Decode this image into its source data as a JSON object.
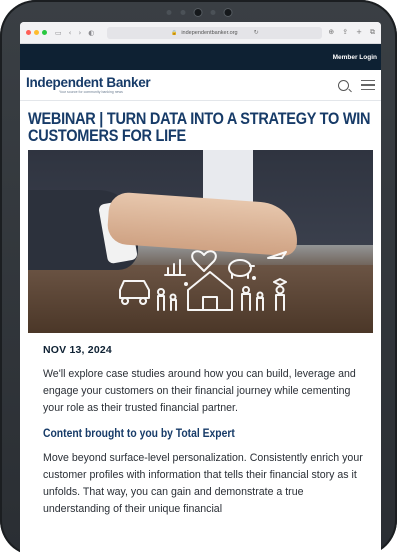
{
  "browser": {
    "url": "independentbanker.org"
  },
  "site": {
    "member_login": "Member Login",
    "logo_text": "Independent Banker",
    "logo_tagline": "Your source for community banking news"
  },
  "article": {
    "title": "WEBINAR | TURN DATA INTO A STRATEGY TO WIN CUSTOMERS FOR LIFE",
    "date": "NOV 13, 2024",
    "intro": "We'll explore case studies around how you can build, leverage and engage your customers on their financial journey while cementing your role as their trusted financial partner.",
    "subhead": "Content brought to you by Total Expert",
    "body": "Move beyond surface-level personalization. Consistently enrich your customer profiles with information that tells their financial story as it unfolds. That way, you can gain and demonstrate a true understanding of their unique financial"
  },
  "icons": {
    "search": "search-icon",
    "menu": "hamburger-menu-icon"
  },
  "colors": {
    "brand_navy": "#173b68",
    "top_bar": "#0e2133"
  }
}
